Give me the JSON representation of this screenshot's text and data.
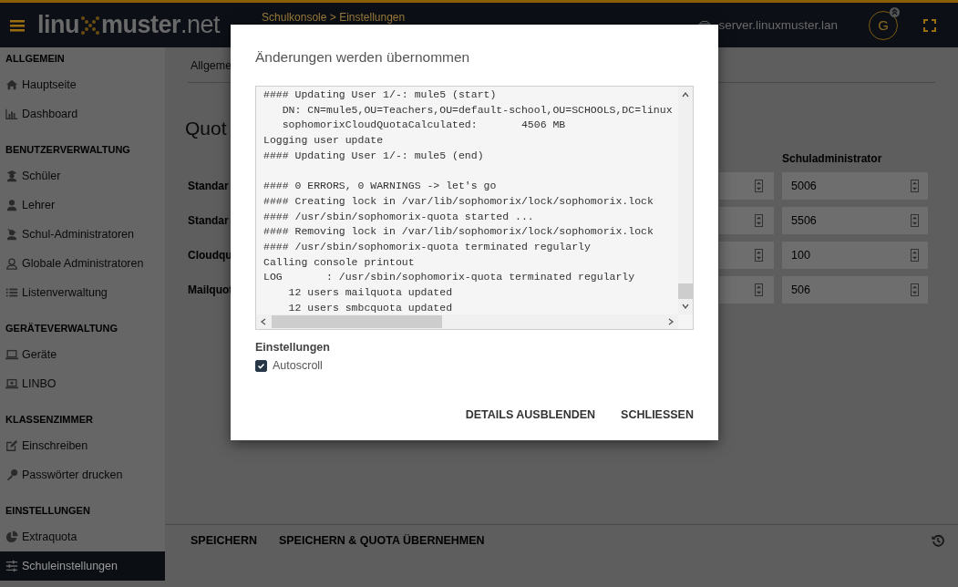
{
  "header": {
    "logo_start": "linu",
    "logo_end": "muster",
    "logo_suffix": ".net",
    "breadcrumb": "Schulkonsole > Einstellungen",
    "server": "server.linuxmuster.lan",
    "avatar": "G"
  },
  "sidebar": {
    "sections": [
      {
        "title": "ALLGEMEIN",
        "items": [
          {
            "label": "Hauptseite",
            "kind": "home",
            "selected": false
          },
          {
            "label": "Dashboard",
            "kind": "chart",
            "selected": false
          }
        ]
      },
      {
        "title": "BENUTZERVERWALTUNG",
        "items": [
          {
            "label": "Schüler",
            "kind": "student",
            "selected": false
          },
          {
            "label": "Lehrer",
            "kind": "user",
            "selected": false
          },
          {
            "label": "Schul-Administratoren",
            "kind": "admin",
            "selected": false
          },
          {
            "label": "Globale Administratoren",
            "kind": "globaladmin",
            "selected": false
          },
          {
            "label": "Listenverwaltung",
            "kind": "list",
            "selected": false
          }
        ]
      },
      {
        "title": "GERÄTEVERWALTUNG",
        "items": [
          {
            "label": "Geräte",
            "kind": "laptop",
            "selected": false
          },
          {
            "label": "LINBO",
            "kind": "linbo",
            "selected": false
          }
        ]
      },
      {
        "title": "KLASSENZIMMER",
        "items": [
          {
            "label": "Einschreiben",
            "kind": "edit",
            "selected": false
          },
          {
            "label": "Passwörter drucken",
            "kind": "key",
            "selected": false
          }
        ]
      },
      {
        "title": "EINSTELLUNGEN",
        "items": [
          {
            "label": "Extraquota",
            "kind": "pie",
            "selected": false
          },
          {
            "label": "Schuleinstellungen",
            "kind": "sliders",
            "selected": true
          }
        ]
      }
    ]
  },
  "content": {
    "tab": "Allgeme",
    "heading": "Quot",
    "column_header": "Schuladministrator",
    "rows": [
      {
        "label": "Standar",
        "value": "5006"
      },
      {
        "label": "Standar",
        "value": "5506"
      },
      {
        "label": "Cloudqu",
        "value": "100"
      },
      {
        "label": "Mailquot",
        "value": "506"
      }
    ]
  },
  "footer": {
    "buttons": [
      "SPEICHERN",
      "SPEICHERN & QUOTA ÜBERNEHMEN"
    ]
  },
  "dialog": {
    "title": "Änderungen werden übernommen",
    "log": [
      [
        "#### Updating User 1/-: mule5 (start)",
        "   DN: CN=mule5,OU=Teachers,OU=default-school,OU=SCHOOLS,DC=linux",
        "   sophomorixCloudQuotaCalculated:       4506 MB",
        "Logging user update",
        "#### Updating User 1/-: mule5 (end)"
      ],
      [
        "#### 0 ERRORS, 0 WARNINGS -> let's go",
        "#### Creating lock in /var/lib/sophomorix/lock/sophomorix.lock",
        "#### /usr/sbin/sophomorix-quota started ...",
        "#### Removing lock in /var/lib/sophomorix/lock/sophomorix.lock",
        "#### /usr/sbin/sophomorix-quota terminated regularly",
        "Calling console printout",
        "LOG       : /usr/sbin/sophomorix-quota terminated regularly",
        "    12 users mailquota updated",
        "    12 users smbcquota updated"
      ]
    ],
    "settings_label": "Einstellungen",
    "autoscroll": {
      "label": "Autoscroll",
      "checked": true
    },
    "buttons": [
      "DETAILS AUSBLENDEN",
      "SCHLIESSEN"
    ]
  }
}
